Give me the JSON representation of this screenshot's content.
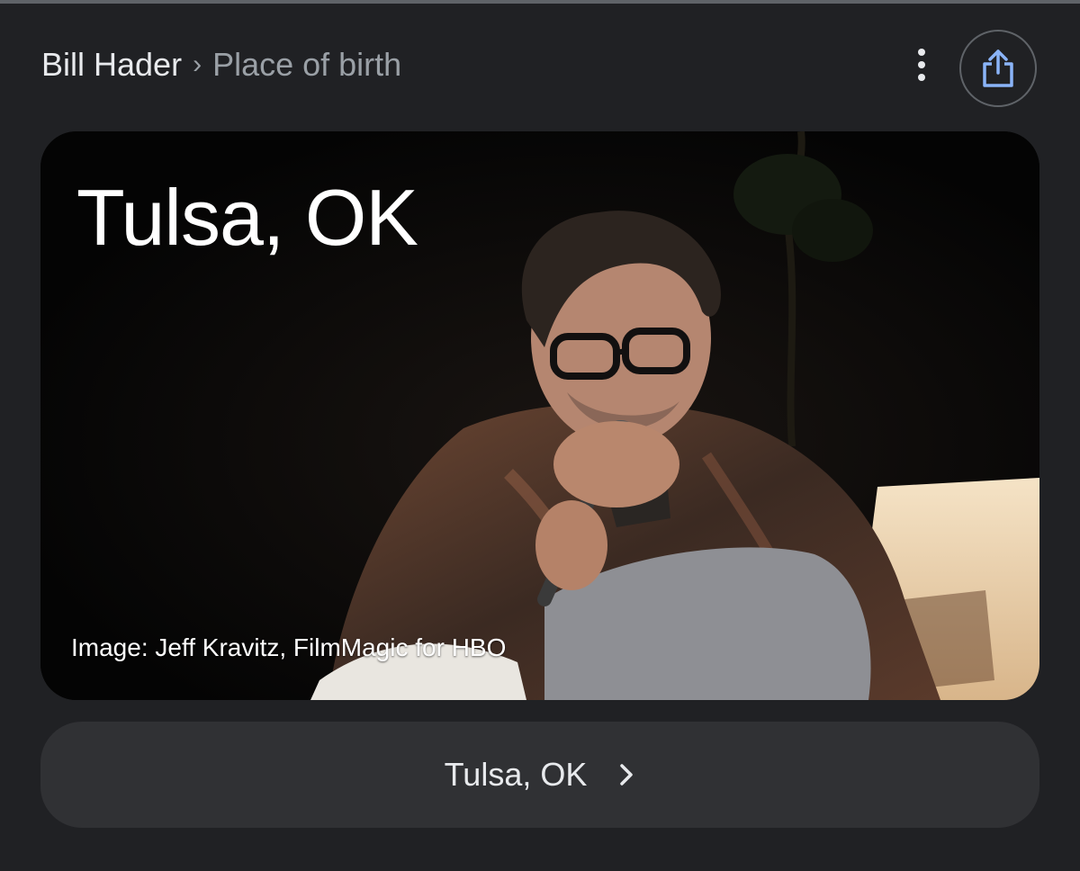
{
  "breadcrumb": {
    "parent": "Bill Hader",
    "separator": "›",
    "current": "Place of birth"
  },
  "toolbar": {
    "more_icon": "more-vert-icon",
    "share_icon": "share-icon"
  },
  "card": {
    "title": "Tulsa, OK",
    "caption": "Image: Jeff Kravitz, FilmMagic for HBO"
  },
  "answer_button": {
    "label": "Tulsa, OK",
    "icon": "chevron-right-icon"
  },
  "colors": {
    "background": "#202124",
    "button_background": "#303134",
    "share_icon": "#8ab4f8",
    "text_primary": "#e8eaed",
    "text_secondary": "#9aa0a6"
  }
}
